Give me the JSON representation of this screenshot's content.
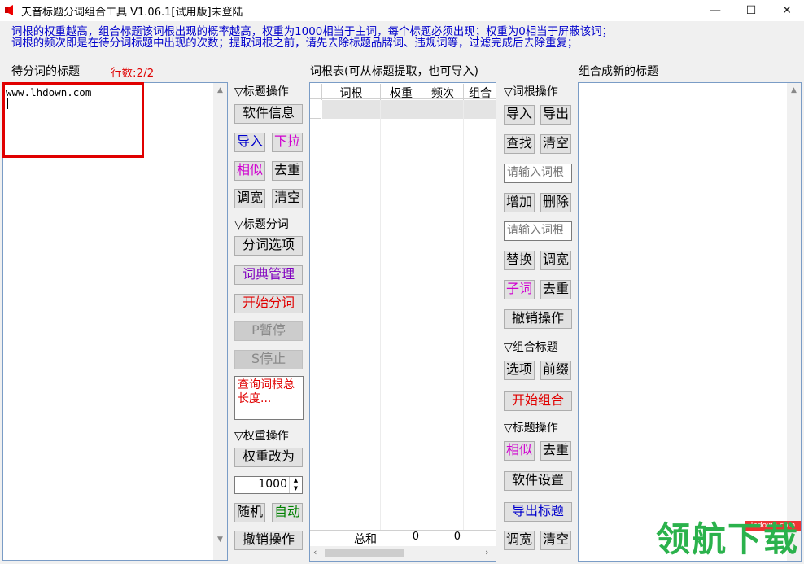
{
  "window": {
    "title": "天音标题分词组合工具 V1.06.1[试用版]未登陆",
    "minimize": "—",
    "maximize": "☐",
    "close": "✕"
  },
  "info": {
    "line1": "词根的权重越高，组合标题该词根出现的概率越高，权重为1000相当于主词，每个标题必须出现；权重为0相当于屏蔽该词；",
    "line2": "词根的频次即是在待分词标题中出现的次数；提取词根之前，请先去除标题品牌词、违规词等，过滤完成后去除重复；"
  },
  "left": {
    "label": "待分词的标题",
    "row_count": "行数:2/2",
    "content": "www.lhdown.com"
  },
  "title_ops": {
    "header": "▽标题操作",
    "software_info": "软件信息",
    "import": "导入",
    "dropdown": "下拉",
    "similar": "相似",
    "dedupe": "去重",
    "widen": "调宽",
    "clear": "清空"
  },
  "segment": {
    "header": "▽标题分词",
    "options": "分词选项",
    "dictionary": "词典管理",
    "start": "开始分词",
    "pause": "P暂停",
    "stop": "S停止",
    "query_text": "查询词根总长度..."
  },
  "weight": {
    "header": "▽权重操作",
    "change_to": "权重改为",
    "value": "1000",
    "random": "随机",
    "auto": "自动",
    "undo": "撤销操作"
  },
  "root_table": {
    "label": "词根表(可从标题提取，也可导入)",
    "columns": [
      "词根",
      "权重",
      "频次",
      "组合"
    ],
    "total_label": "总和",
    "total_weight": "0",
    "total_freq": "0"
  },
  "root_ops": {
    "header": "▽词根操作",
    "import": "导入",
    "export": "导出",
    "find": "查找",
    "clear": "清空",
    "input1_placeholder": "请输入词根",
    "add": "增加",
    "delete": "删除",
    "input2_placeholder": "请输入词根",
    "replace": "替换",
    "widen": "调宽",
    "subword": "子词",
    "dedupe": "去重",
    "undo": "撤销操作"
  },
  "combine": {
    "header": "▽组合标题",
    "options": "选项",
    "prefix": "前缀",
    "start": "开始组合"
  },
  "title_ops2": {
    "header": "▽标题操作",
    "similar": "相似",
    "dedupe": "去重",
    "settings": "软件设置",
    "export": "导出标题",
    "widen": "调宽",
    "clear": "清空"
  },
  "right": {
    "label": "组合成新的标题"
  },
  "watermark": {
    "text": "领航下载",
    "site": "lhdown.com"
  },
  "colors": {
    "blue_text": "#0000cc",
    "red_text": "#e00000",
    "magenta_text": "#d000d0",
    "purple_text": "#8000c0",
    "green_text": "#008000",
    "highlight_red": "#e00000"
  }
}
